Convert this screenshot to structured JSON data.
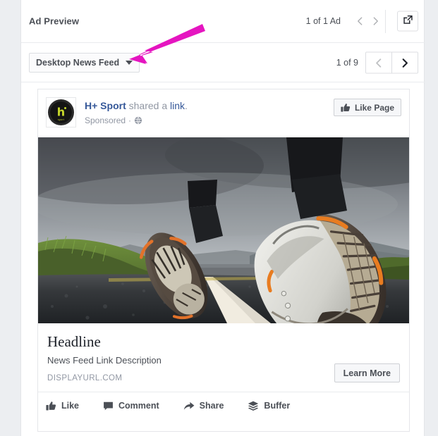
{
  "colors": {
    "accent_blue": "#365899",
    "annotation_magenta": "#e515c0",
    "panel_bg": "#ffffff",
    "page_bg": "#eceef1",
    "text_dark": "#1d2129",
    "text_muted": "#9197a3",
    "logo_green": "#c9d92b"
  },
  "header": {
    "title": "Ad Preview",
    "ad_count": "1 of 1 Ad",
    "prev_icon": "chevron-left-icon",
    "next_icon": "chevron-right-icon",
    "popout_icon": "external-link-icon"
  },
  "selector": {
    "placement_label": "Desktop News Feed",
    "caret_icon": "chevron-down-icon",
    "page_count": "1 of 9",
    "prev_icon": "chevron-left-icon",
    "next_icon": "chevron-right-icon"
  },
  "annotation": {
    "shape": "arrow",
    "points_to": "Desktop News Feed",
    "color": "#e515c0"
  },
  "post": {
    "avatar": {
      "icon": "page-avatar",
      "logo_letter": "h",
      "logo_subtext": "sport"
    },
    "page_name": "H+ Sport",
    "shared_text": " shared a ",
    "link_word": "link",
    "period": ".",
    "sponsored_label": "Sponsored",
    "separator": "·",
    "privacy_icon": "globe-icon",
    "like_page_button": "Like Page",
    "like_page_icon": "thumbs-up-icon",
    "image_alt": "running-shoes-on-road-photo",
    "link": {
      "headline": "Headline",
      "description": "News Feed Link Description",
      "display_url": "DISPLAYURL.COM",
      "cta_label": "Learn More"
    },
    "actions": [
      {
        "label": "Like",
        "icon": "thumbs-up-icon"
      },
      {
        "label": "Comment",
        "icon": "comment-icon"
      },
      {
        "label": "Share",
        "icon": "share-arrow-icon"
      },
      {
        "label": "Buffer",
        "icon": "buffer-stack-icon"
      }
    ]
  }
}
